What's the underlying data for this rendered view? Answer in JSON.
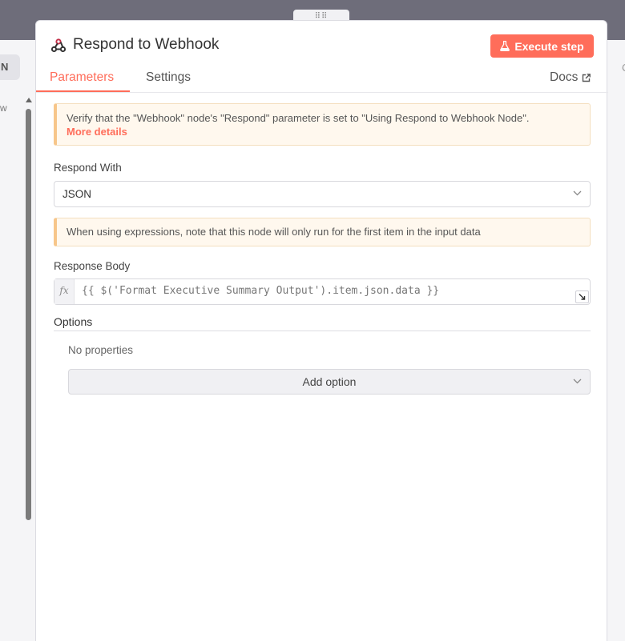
{
  "backdrop": {
    "left_tag": "N",
    "left_text": "w",
    "right_text": "C",
    "drag_handle": "⠿⠿"
  },
  "panel": {
    "title": "Respond to Webhook",
    "execute_label": "Execute step",
    "tabs": [
      {
        "label": "Parameters",
        "active": true
      },
      {
        "label": "Settings",
        "active": false
      }
    ],
    "docs_label": "Docs"
  },
  "notice": {
    "text": "Verify that the \"Webhook\" node's \"Respond\" parameter is set to \"Using Respond to Webhook Node\".",
    "link": "More details"
  },
  "respond_with": {
    "label": "Respond With",
    "value": "JSON"
  },
  "expression_notice": "When using expressions, note that this node will only run for the first item in the input data",
  "response_body": {
    "label": "Response Body",
    "fx": "fx",
    "expression": "{{ $('Format Executive Summary Output').item.json.data }}"
  },
  "options": {
    "label": "Options",
    "empty": "No properties",
    "add_label": "Add option"
  },
  "colors": {
    "accent": "#ff6d5a",
    "notice_bg": "#fff8ee",
    "backdrop": "#6e6d7a"
  }
}
